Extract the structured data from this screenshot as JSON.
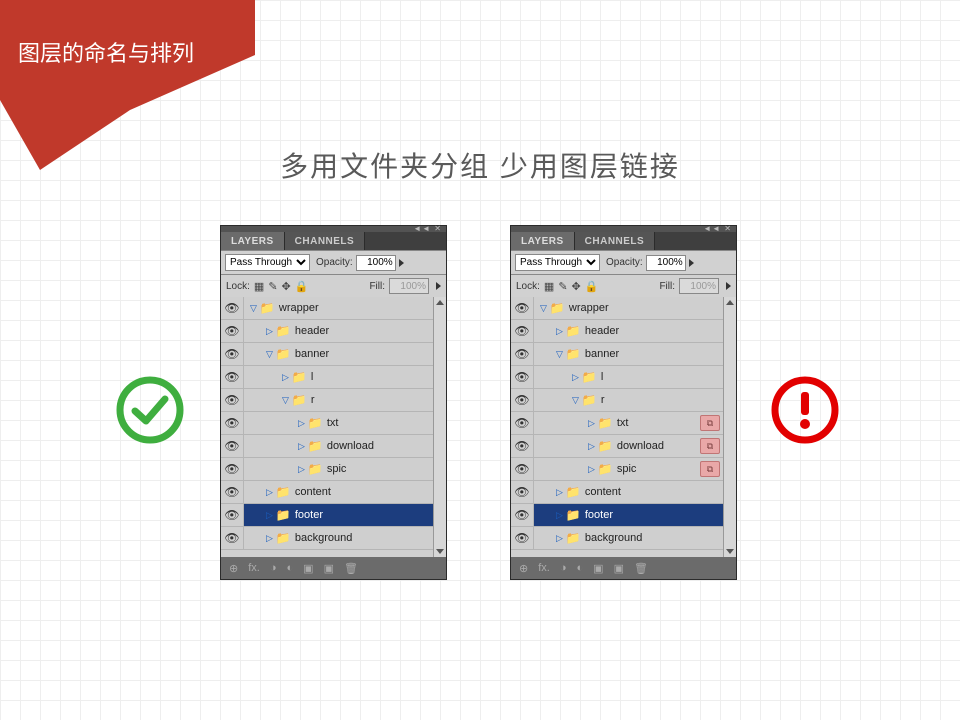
{
  "title": "图层的命名与排列",
  "heading": "多用文件夹分组  少用图层链接",
  "tabs": {
    "layers": "LAYERS",
    "channels": "CHANNELS"
  },
  "options": {
    "blend_mode": "Pass Through",
    "opacity_label": "Opacity:",
    "opacity_value": "100%",
    "lock_label": "Lock:",
    "fill_label": "Fill:",
    "fill_value": "100%"
  },
  "layers": [
    {
      "indent": 0,
      "open": true,
      "name": "wrapper",
      "selected": false,
      "link": false
    },
    {
      "indent": 1,
      "open": false,
      "name": "header",
      "selected": false,
      "link": false
    },
    {
      "indent": 1,
      "open": true,
      "name": "banner",
      "selected": false,
      "link": false
    },
    {
      "indent": 2,
      "open": false,
      "name": "l",
      "selected": false,
      "link": false
    },
    {
      "indent": 2,
      "open": true,
      "name": "r",
      "selected": false,
      "link": false
    },
    {
      "indent": 3,
      "open": false,
      "name": "txt",
      "selected": false,
      "link_right": true
    },
    {
      "indent": 3,
      "open": false,
      "name": "download",
      "selected": false,
      "link_right": true
    },
    {
      "indent": 3,
      "open": false,
      "name": "spic",
      "selected": false,
      "link_right": true
    },
    {
      "indent": 1,
      "open": false,
      "name": "content",
      "selected": false,
      "link": false
    },
    {
      "indent": 1,
      "open": false,
      "name": "footer",
      "selected": true,
      "link": false
    },
    {
      "indent": 1,
      "open": false,
      "name": "background",
      "selected": false,
      "link": false
    }
  ],
  "bottom_icons": [
    "⊕",
    "fx.",
    "◑",
    "◐",
    "▣",
    "▣",
    "🗑"
  ]
}
